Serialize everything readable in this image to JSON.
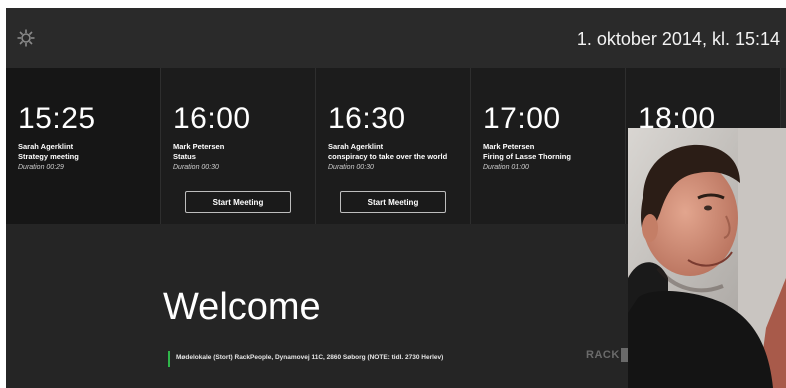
{
  "header": {
    "settings_icon": "gear-icon",
    "datetime": "1. oktober 2014, kl. 15:14"
  },
  "meetings": [
    {
      "time": "15:25",
      "organizer": "Sarah Agerklint",
      "subject": "Strategy meeting",
      "duration": "Duration 00:29",
      "button": ""
    },
    {
      "time": "16:00",
      "organizer": "Mark Petersen",
      "subject": "Status",
      "duration": "Duration 00:30",
      "button": "Start Meeting"
    },
    {
      "time": "16:30",
      "organizer": "Sarah Agerklint",
      "subject": "conspiracy to take over the world",
      "duration": "Duration 00:30",
      "button": "Start Meeting"
    },
    {
      "time": "17:00",
      "organizer": "Mark Petersen",
      "subject": "Firing of Lasse Thorning",
      "duration": "Duration 01:00",
      "button": ""
    },
    {
      "time": "18:00",
      "organizer": "",
      "subject": "",
      "duration": "",
      "button": ""
    }
  ],
  "welcome": {
    "title": "Welcome",
    "location": "Mødelokale (Stort) RackPeople, Dynamovej 11C, 2860 Søborg (NOTE: tidl. 2730 Herlev)"
  },
  "logo": {
    "text": "RACK"
  },
  "colors": {
    "background": "#252525",
    "card": "#1c1c1c",
    "accent": "#2fb54a"
  }
}
